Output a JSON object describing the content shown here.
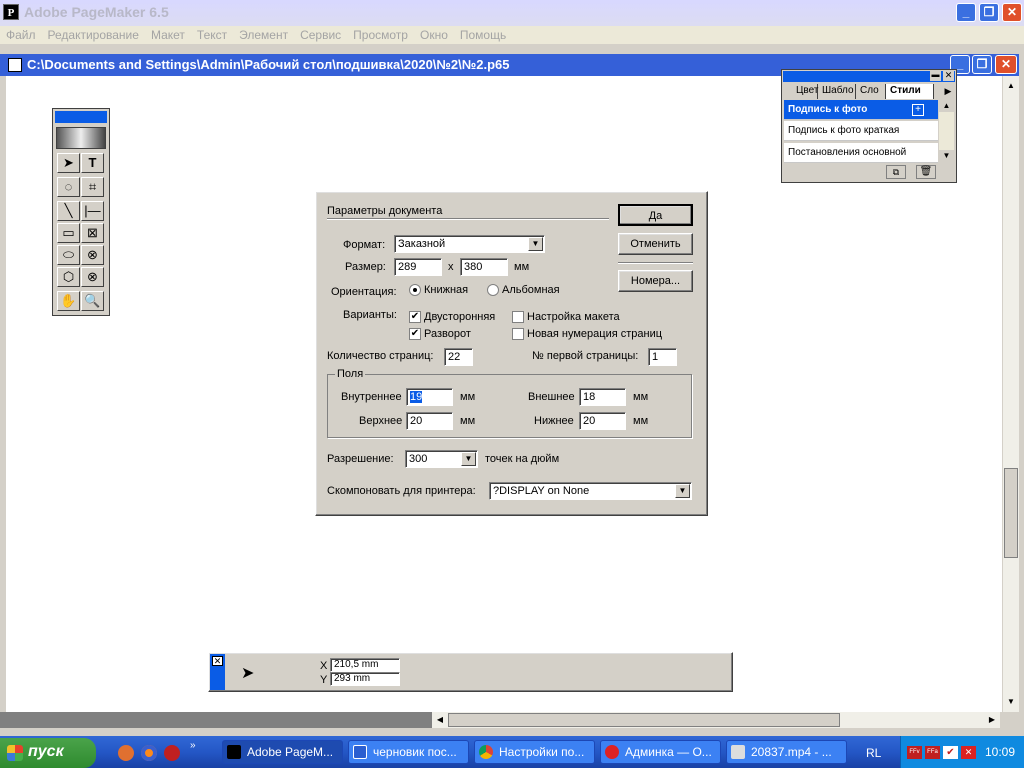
{
  "app": {
    "title": "Adobe PageMaker 6.5",
    "menu": [
      "Файл",
      "Редактирование",
      "Макет",
      "Текст",
      "Элемент",
      "Сервис",
      "Просмотр",
      "Окно",
      "Помощь"
    ]
  },
  "document": {
    "title": "C:\\Documents and Settings\\Admin\\Рабочий стол\\подшивка\\2020\\№2\\№2.p65"
  },
  "palette": {
    "tabs": [
      "Цвет",
      "Шабло",
      "Сло",
      "Стили"
    ],
    "items": [
      "Подпись к фото",
      "Подпись к фото  краткая",
      "Постановления  основной"
    ]
  },
  "dialog": {
    "title": "Параметры документа",
    "ok_label": "Да",
    "cancel_label": "Отменить",
    "numbers_label": "Номера...",
    "format_label": "Формат:",
    "format_value": "Заказной",
    "size_label": "Размер:",
    "width": "289",
    "x_label": "x",
    "height": "380",
    "unit": "мм",
    "orientation_label": "Ориентация:",
    "portrait_label": "Книжная",
    "landscape_label": "Альбомная",
    "options_label": "Варианты:",
    "double_sided_label": "Двусторонняя",
    "facing_label": "Разворот",
    "adjust_layout_label": "Настройка макета",
    "restart_numbering_label": "Новая нумерация страниц",
    "pages_count_label": "Количество страниц:",
    "pages_count": "22",
    "first_page_label": "№ первой страницы:",
    "first_page": "1",
    "margins_label": "Поля",
    "inner_label": "Внутреннее",
    "inner": "19",
    "outer_label": "Внешнее",
    "outer": "18",
    "top_label": "Верхнее",
    "top": "20",
    "bottom_label": "Нижнее",
    "bottom": "20",
    "resolution_label": "Разрешение:",
    "resolution": "300",
    "dpi_label": "точек на дюйм",
    "printer_label": "Скомпоновать для принтера:",
    "printer": "?DISPLAY on None"
  },
  "control": {
    "x_label": "X",
    "x_value": "210,5 mm",
    "y_label": "Y",
    "y_value": "293 mm"
  },
  "taskbar": {
    "start_label": "пуск",
    "tasks": [
      "Adobe PageM...",
      "черновик пос...",
      "Настройки по...",
      "Админка — О...",
      "20837.mp4 - ..."
    ],
    "lang": "RL",
    "clock": "10:09"
  },
  "colors": {
    "title_blue": "#3560d8",
    "selection_blue": "#0a5ce6",
    "taskbar_blue": "#2457c6",
    "start_green": "#3a983a"
  }
}
